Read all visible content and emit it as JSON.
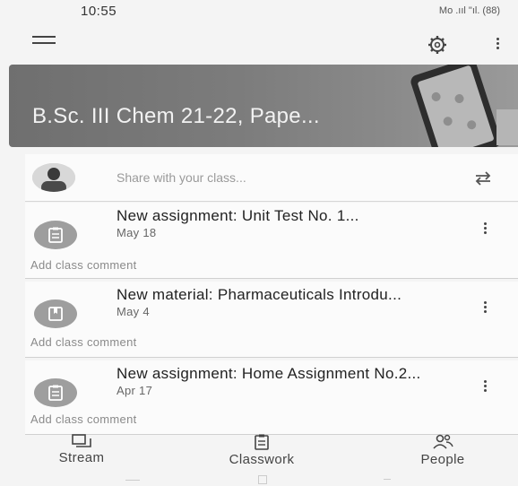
{
  "status_bar": {
    "time": "10:55",
    "indicators": "Mo .ııl \"ıl. (88)"
  },
  "header": {
    "menu_icon": "hamburger-icon",
    "settings_icon": "gear-icon",
    "more_icon": "kebab-icon"
  },
  "banner": {
    "title": "B.Sc. III Chem 21-22, Pape..."
  },
  "share": {
    "placeholder": "Share with your class...",
    "avatar": "avatar-photo",
    "repost_icon": "repost-icon"
  },
  "posts": [
    {
      "title": "New assignment: Unit Test No. 1...",
      "date": "May 18",
      "icon": "assignment-icon",
      "comment": "Add class comment"
    },
    {
      "title": "New material: Pharmaceuticals Introdu...",
      "date": "May 4",
      "icon": "material-icon",
      "comment": "Add class comment"
    },
    {
      "title": "New assignment: Home Assignment No.2...",
      "date": "Apr 17",
      "icon": "assignment-icon",
      "comment": "Add class comment"
    }
  ],
  "bottom_nav": [
    {
      "label": "Stream",
      "icon": "stream-icon",
      "active": true
    },
    {
      "label": "Classwork",
      "icon": "classwork-icon",
      "active": false
    },
    {
      "label": "People",
      "icon": "people-icon",
      "active": false
    }
  ],
  "colors": {
    "banner": "#7c7c7c",
    "card": "#fbfbfb",
    "background": "#f4f4f4",
    "icon_circle": "#9e9e9e"
  }
}
